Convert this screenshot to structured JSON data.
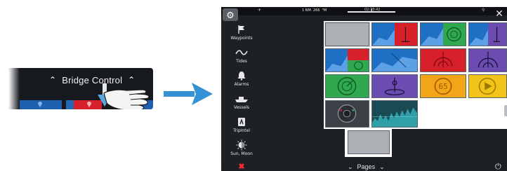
{
  "bridge": {
    "title": "Bridge Control",
    "chevron_left": "⌃",
    "chevron_right": "⌃"
  },
  "device": {
    "status": {
      "distance_value": "1 NM",
      "speed_value": "266",
      "unit": "°M",
      "time": "02:23:42"
    },
    "settings_icon": "⚙",
    "close_icon": "✕",
    "sidebar": {
      "items": [
        {
          "label": "Waypoints",
          "icon": "flag-icon"
        },
        {
          "label": "Tides",
          "icon": "wave-icon"
        },
        {
          "label": "Alarms",
          "icon": "bell-icon"
        },
        {
          "label": "Vessels",
          "icon": "ship-icon"
        },
        {
          "label": "TripIntel",
          "icon": "tripintel-icon"
        },
        {
          "label": "Sun, Moon",
          "icon": "sun-moon-icon"
        }
      ]
    },
    "bottom": {
      "exit_icon": "✖",
      "pages_label": "Pages",
      "pages_chevron": "⌄",
      "power_icon": "⏻"
    },
    "colors": {
      "chart_blue": "#1f6fc4",
      "chart_red": "#d72029",
      "chart_green": "#2fa84f",
      "chart_purple": "#6b4cb0",
      "chart_orange": "#f2a518",
      "chart_yellow": "#f2c318",
      "tile_gray": "#adb1b6",
      "accent_arrow": "#3391d4"
    }
  }
}
